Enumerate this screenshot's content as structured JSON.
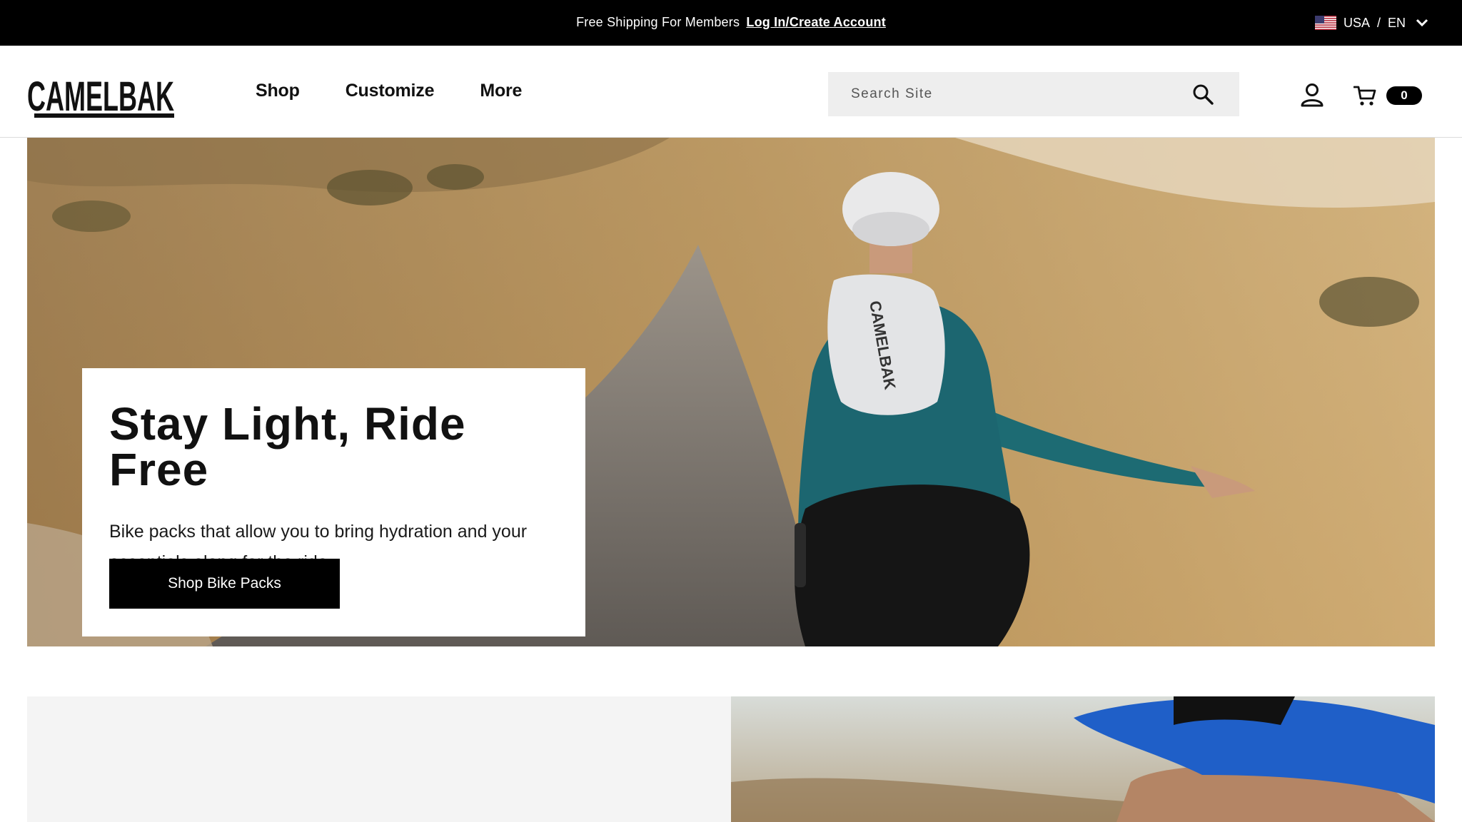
{
  "announcement": {
    "text": "Free Shipping For Members",
    "link": "Log In/Create Account"
  },
  "locale": {
    "country": "USA",
    "separator": "/",
    "language": "EN",
    "flag_icon": "us-flag-icon"
  },
  "header": {
    "logo_text": "CAMELBAK",
    "nav": [
      "Shop",
      "Customize",
      "More"
    ],
    "search_placeholder": "Search Site",
    "cart_count": "0"
  },
  "hero": {
    "title": "Stay Light, Ride Free",
    "body": "Bike packs that allow you to bring hydration and your essentials along for the ride.",
    "cta": "Shop Bike Packs"
  },
  "colors": {
    "topbar_bg": "#000000",
    "search_bg": "#eeeeee",
    "cta_bg": "#000000",
    "section_bg": "#f4f4f4"
  }
}
